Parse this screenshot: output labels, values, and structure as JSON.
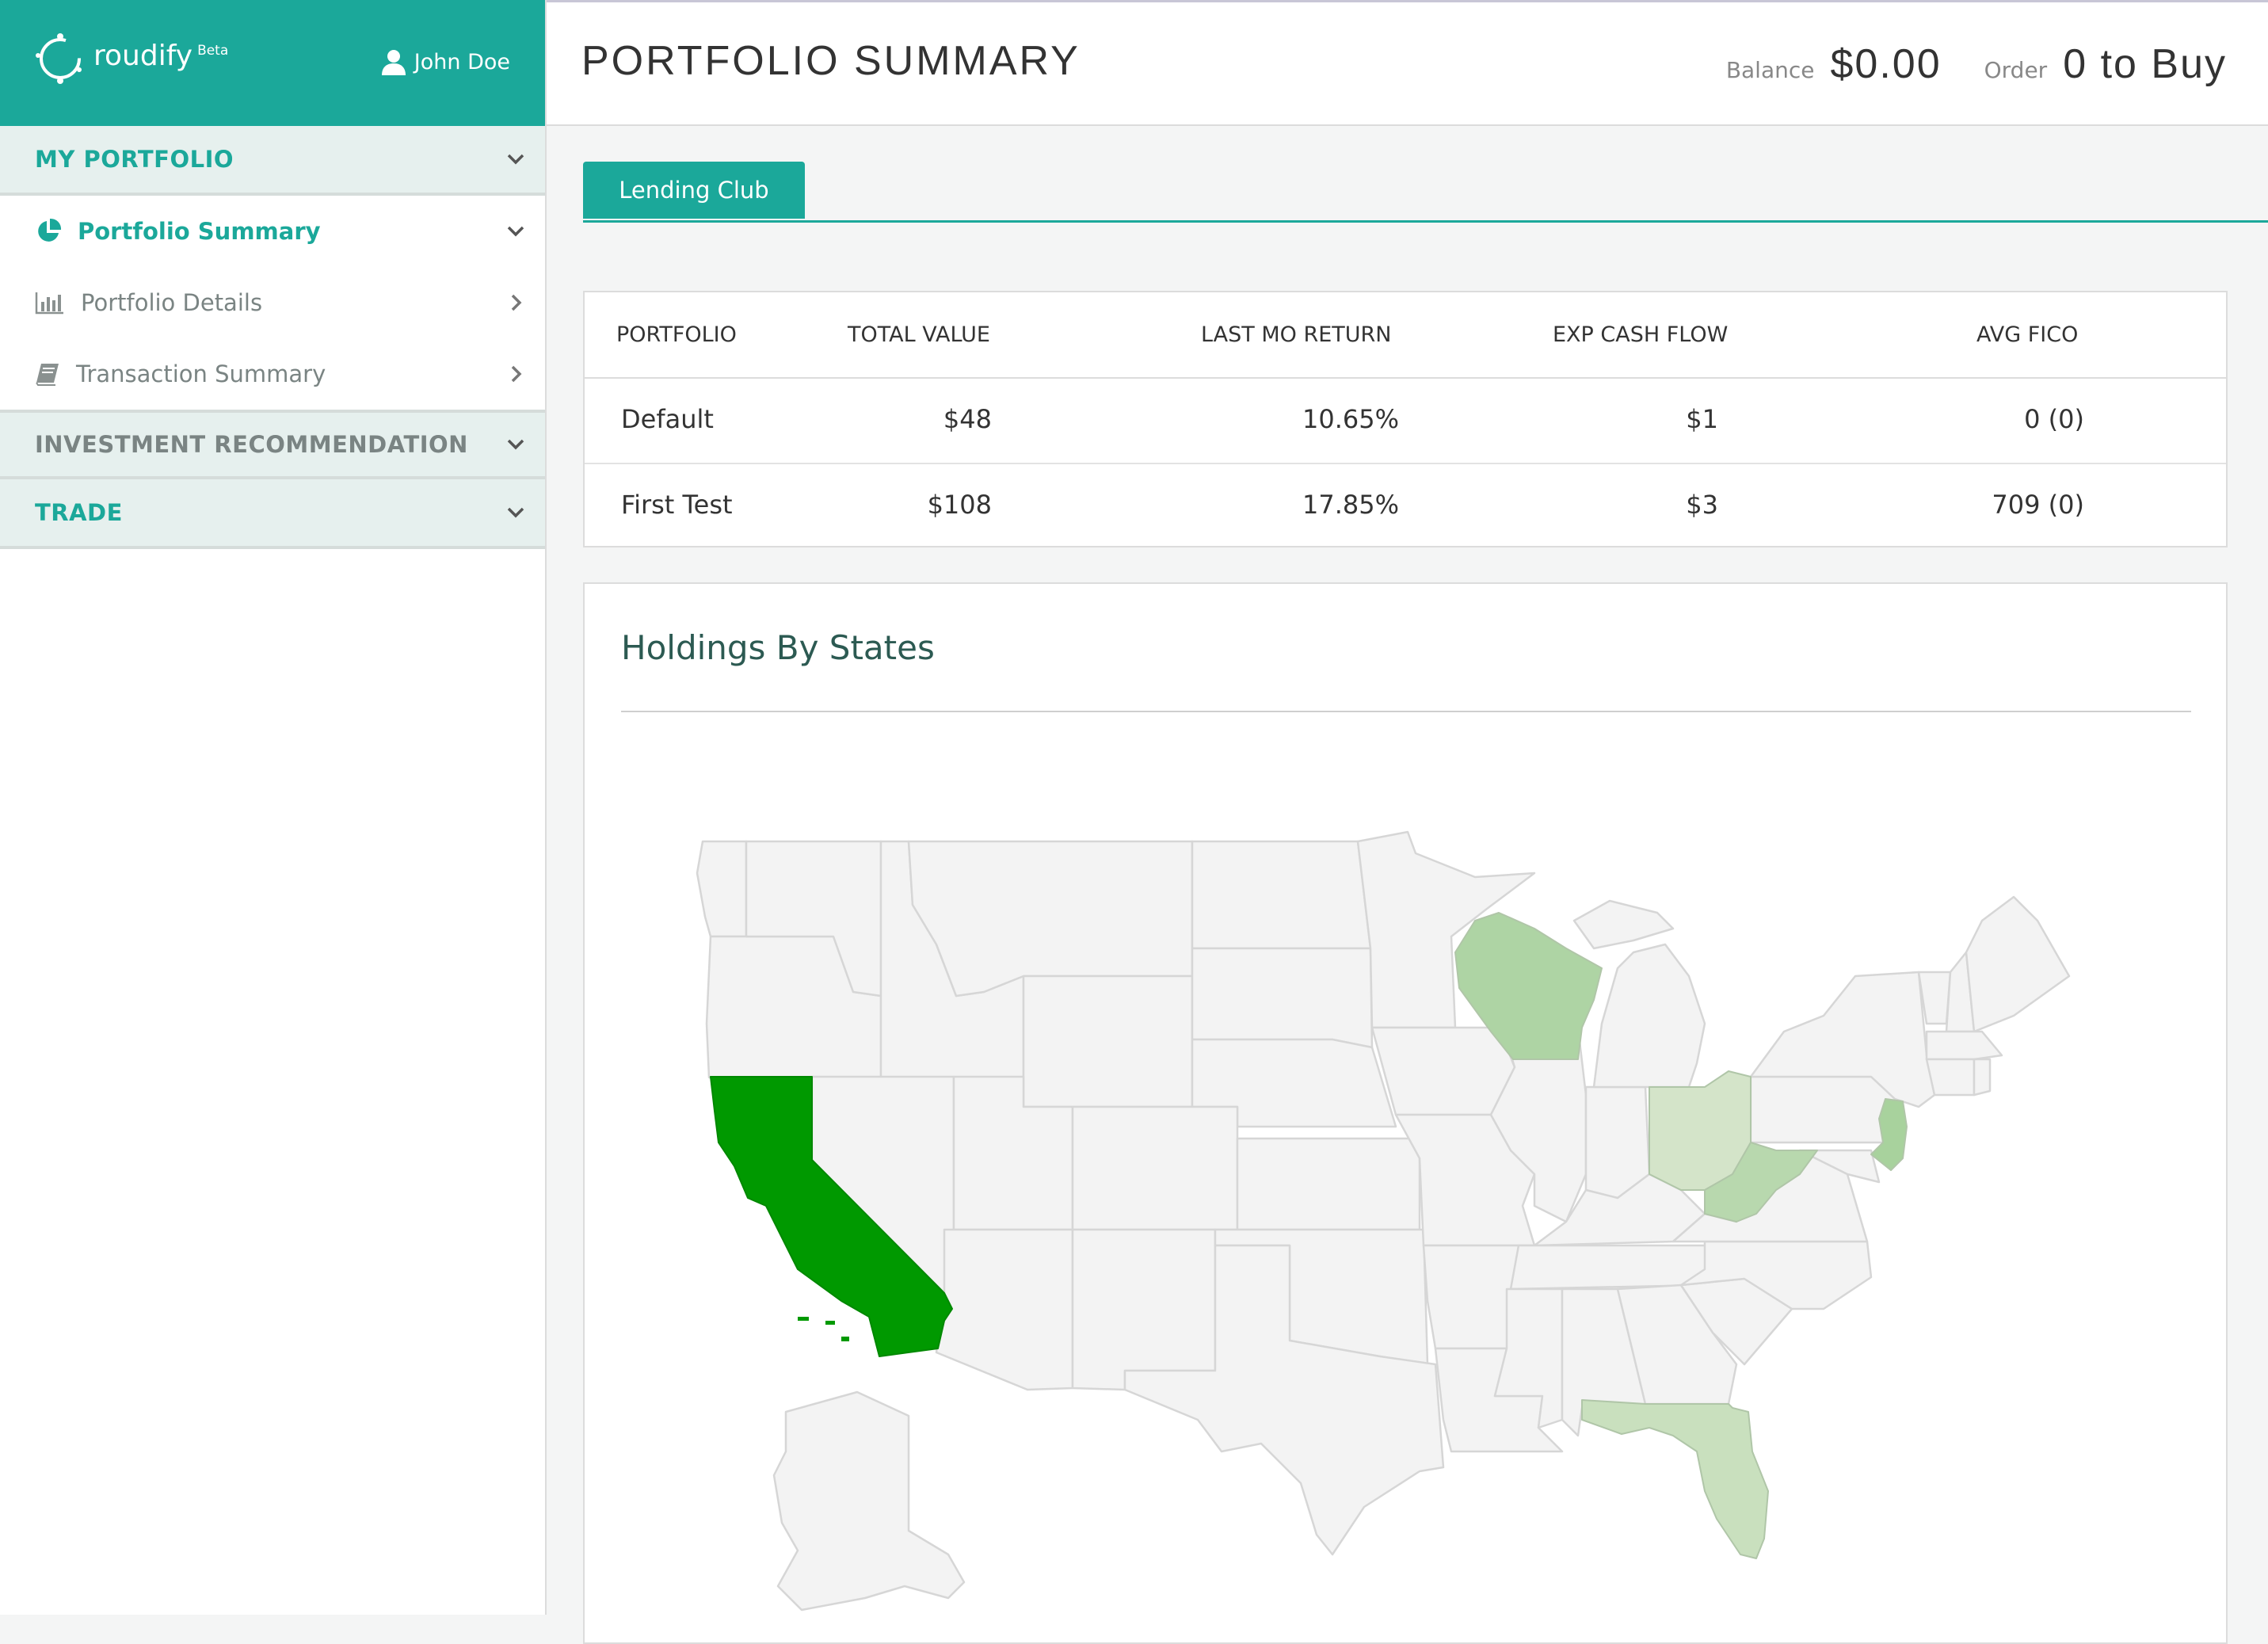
{
  "brand": {
    "name": "roudify",
    "tag": "Beta"
  },
  "user": {
    "name": "John Doe"
  },
  "header": {
    "title": "PORTFOLIO SUMMARY",
    "balance_label": "Balance",
    "balance_value": "$0.00",
    "order_label": "Order",
    "order_value": "0 to Buy"
  },
  "sidebar": {
    "sections": [
      {
        "label": "MY PORTFOLIO",
        "items": [
          {
            "label": "Portfolio Summary",
            "icon": "pie-chart-icon",
            "active": true
          },
          {
            "label": "Portfolio Details",
            "icon": "bar-chart-icon",
            "active": false
          },
          {
            "label": "Transaction Summary",
            "icon": "book-icon",
            "active": false
          }
        ]
      },
      {
        "label": "INVESTMENT RECOMMENDATION"
      },
      {
        "label": "TRADE"
      }
    ]
  },
  "tabs": [
    "Lending Club"
  ],
  "table": {
    "columns": [
      "PORTFOLIO",
      "TOTAL VALUE",
      "LAST MO RETURN",
      "EXP CASH FLOW",
      "AVG FICO"
    ],
    "rows": [
      [
        "Default",
        "$48",
        "10.65%",
        "$1",
        "0 (0)"
      ],
      [
        "First Test",
        "$108",
        "17.85%",
        "$3",
        "709 (0)"
      ]
    ]
  },
  "map": {
    "title": "Holdings By States",
    "base_color": "#f3f3f3",
    "border_color": "#d6d6d6",
    "highlighted_states": [
      {
        "state": "CA",
        "color": "#009900"
      },
      {
        "state": "WI",
        "color": "#aed4a4"
      },
      {
        "state": "OH",
        "color": "#d4e4c9"
      },
      {
        "state": "WV",
        "color": "#b8d8ae"
      },
      {
        "state": "NJ",
        "color": "#a8d29d"
      },
      {
        "state": "FL",
        "color": "#c9e0be"
      }
    ]
  },
  "colors": {
    "accent": "#1ba89a"
  }
}
